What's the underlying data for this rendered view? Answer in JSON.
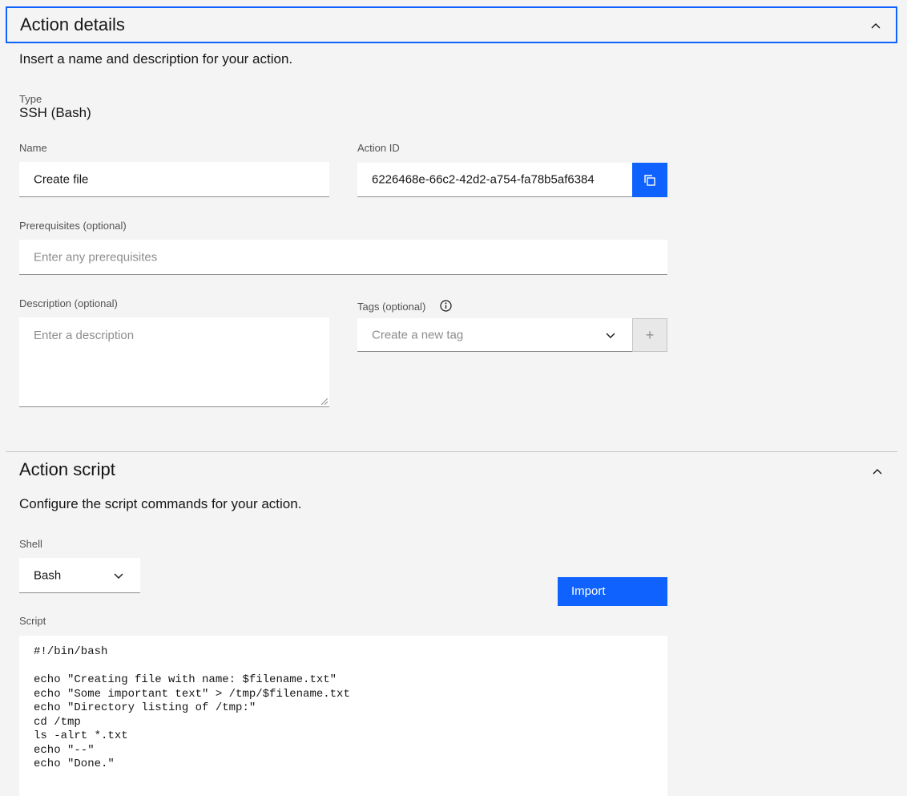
{
  "action_details": {
    "title": "Action details",
    "description": "Insert a name and description for your action.",
    "type_label": "Type",
    "type_value": "SSH (Bash)",
    "name_label": "Name",
    "name_value": "Create file",
    "action_id_label": "Action ID",
    "action_id_value": "6226468e-66c2-42d2-a754-fa78b5af6384",
    "prerequisites_label": "Prerequisites (optional)",
    "prerequisites_placeholder": "Enter any prerequisites",
    "description_label": "Description (optional)",
    "description_placeholder": "Enter a description",
    "tags_label": "Tags (optional)",
    "tags_placeholder": "Create a new tag",
    "add_tag_symbol": "+"
  },
  "action_script": {
    "title": "Action script",
    "description": "Configure the script commands for your action.",
    "shell_label": "Shell",
    "shell_value": "Bash",
    "import_label": "Import",
    "script_label": "Script",
    "script_lines": [
      "#!/bin/bash",
      "",
      "echo \"Creating file with name: $filename.txt\"",
      "echo \"Some important text\" > /tmp/$filename.txt",
      "echo \"Directory listing of /tmp:\"",
      "cd /tmp",
      "ls -alrt *.txt",
      "echo \"--\"",
      "echo \"Done.\""
    ]
  },
  "icons": {
    "collapse": "chevron-up-icon",
    "copy": "copy-icon",
    "info": "information-icon",
    "dropdown": "chevron-down-icon"
  },
  "colors": {
    "accent": "#0f62fe",
    "background": "#f4f4f4",
    "field": "#ffffff"
  }
}
